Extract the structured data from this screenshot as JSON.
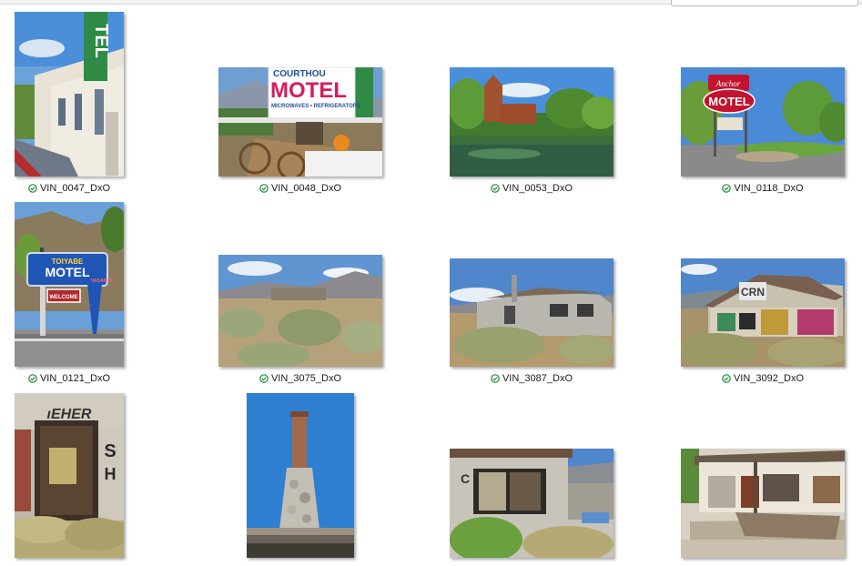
{
  "window": {
    "search_placeholder": ""
  },
  "files": [
    {
      "name": "VIN_0047_DxO",
      "status_icon": "check-circle-icon",
      "subject": "motel-sign-street"
    },
    {
      "name": "VIN_0048_DxO",
      "status_icon": "check-circle-icon",
      "subject": "courthouse-motel-wagon"
    },
    {
      "name": "VIN_0053_DxO",
      "status_icon": "check-circle-icon",
      "subject": "pond-building"
    },
    {
      "name": "VIN_0118_DxO",
      "status_icon": "check-circle-icon",
      "subject": "motel-sign-trees"
    },
    {
      "name": "VIN_0121_DxO",
      "status_icon": "check-circle-icon",
      "subject": "toiyabe-motel-sign"
    },
    {
      "name": "VIN_3075_DxO",
      "status_icon": "check-circle-icon",
      "subject": "desert-ruins"
    },
    {
      "name": "VIN_3087_DxO",
      "status_icon": "check-circle-icon",
      "subject": "stone-ruin"
    },
    {
      "name": "VIN_3092_DxO",
      "status_icon": "check-circle-icon",
      "subject": "graffiti-building"
    },
    {
      "name": "",
      "status_icon": "check-circle-icon",
      "subject": "graffiti-doorway"
    },
    {
      "name": "",
      "status_icon": "check-circle-icon",
      "subject": "stone-chimney"
    },
    {
      "name": "",
      "status_icon": "check-circle-icon",
      "subject": "ruin-window"
    },
    {
      "name": "",
      "status_icon": "check-circle-icon",
      "subject": "abandoned-station"
    }
  ],
  "signs": {
    "tel": "TEL",
    "courthouse": "COURTHOU",
    "motel": "MOTEL",
    "microwaves": "MICROWAVES • REFRIGERATORS",
    "anchor": "Anchor",
    "toiyabe": "TOIYABE",
    "vacancy": "VACANCY",
    "welcome": "WELCOME"
  }
}
